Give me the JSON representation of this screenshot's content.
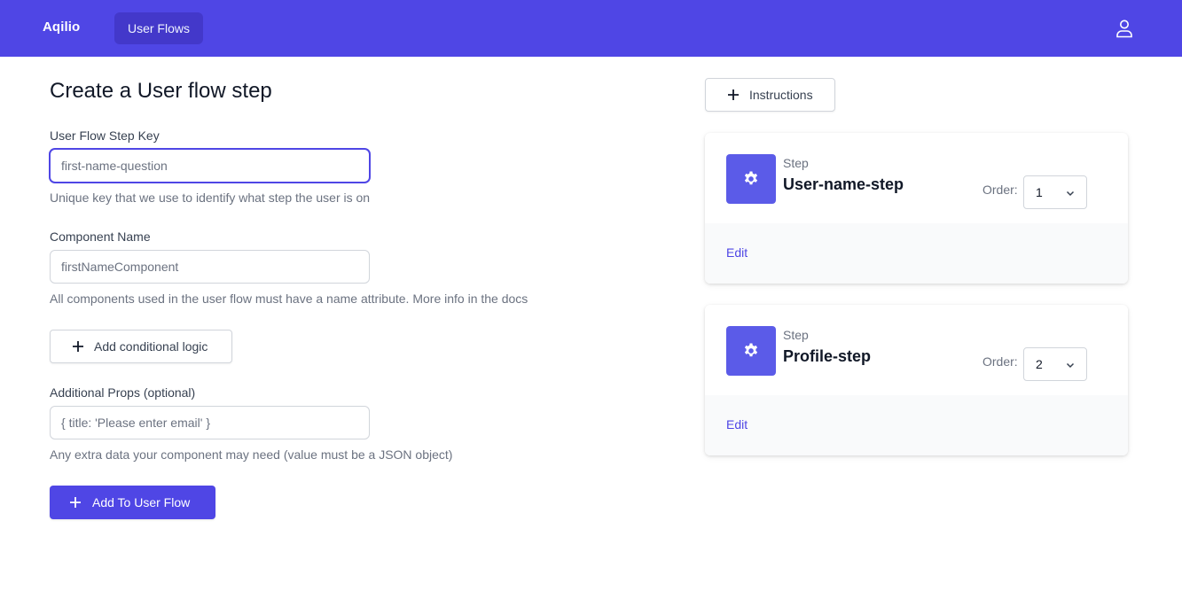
{
  "nav": {
    "brand": "Aqilio",
    "tabs": [
      {
        "label": "User Flows"
      }
    ],
    "colors": {
      "accent": "#4f46e5",
      "active_tab": "#4338ca"
    }
  },
  "form": {
    "title": "Create a User flow step",
    "step_key": {
      "label": "User Flow Step Key",
      "placeholder": "first-name-question",
      "value": "",
      "help": "Unique key that we use to identify what step the user is on"
    },
    "component_name": {
      "label": "Component Name",
      "placeholder": "firstNameComponent",
      "value": "",
      "help": "All components used in the user flow must have a name attribute. More info in the docs"
    },
    "conditional_button_label": "Add conditional logic",
    "additional_props": {
      "label": "Additional Props (optional)",
      "placeholder": "{ title: 'Please enter email' }",
      "value": "",
      "help": "Any extra data your component may need (value must be a JSON object)"
    },
    "submit_label": "Add To User Flow"
  },
  "instructions_label": "Instructions",
  "steps": [
    {
      "kicker": "Step",
      "name": "User-name-step",
      "order_label": "Order:",
      "order": "1",
      "edit_label": "Edit",
      "icon": "gear-icon"
    },
    {
      "kicker": "Step",
      "name": "Profile-step",
      "order_label": "Order:",
      "order": "2",
      "edit_label": "Edit",
      "icon": "gear-icon"
    }
  ]
}
